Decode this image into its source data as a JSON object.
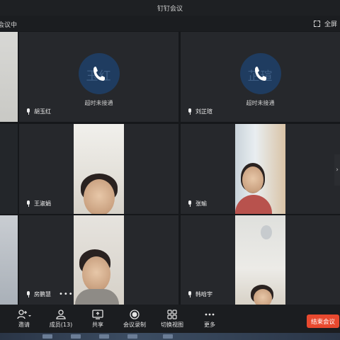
{
  "window": {
    "title": "钉钉会议"
  },
  "subbar": {
    "status": "会议中",
    "fullscreen_label": "全屏"
  },
  "tiles": [
    {
      "name": "胡玉红",
      "avatar_text": "玉红",
      "status": "超时未接通"
    },
    {
      "name": "刘芷瑄",
      "avatar_text": "芷瑄",
      "status": "超时未接通"
    },
    {
      "name": "王淑娟"
    },
    {
      "name": "张瑜"
    },
    {
      "name": "房鹏慧",
      "more": "•••"
    },
    {
      "name": "韩晗宇"
    }
  ],
  "toolbar": {
    "invite": "邀请",
    "members": "成员(13)",
    "share": "共享",
    "record": "会议录制",
    "switch_view": "切换视图",
    "more": "更多",
    "end": "结束会议"
  },
  "colors": {
    "end_button": "#e8492f",
    "avatar_bg": "#1f3c60"
  }
}
